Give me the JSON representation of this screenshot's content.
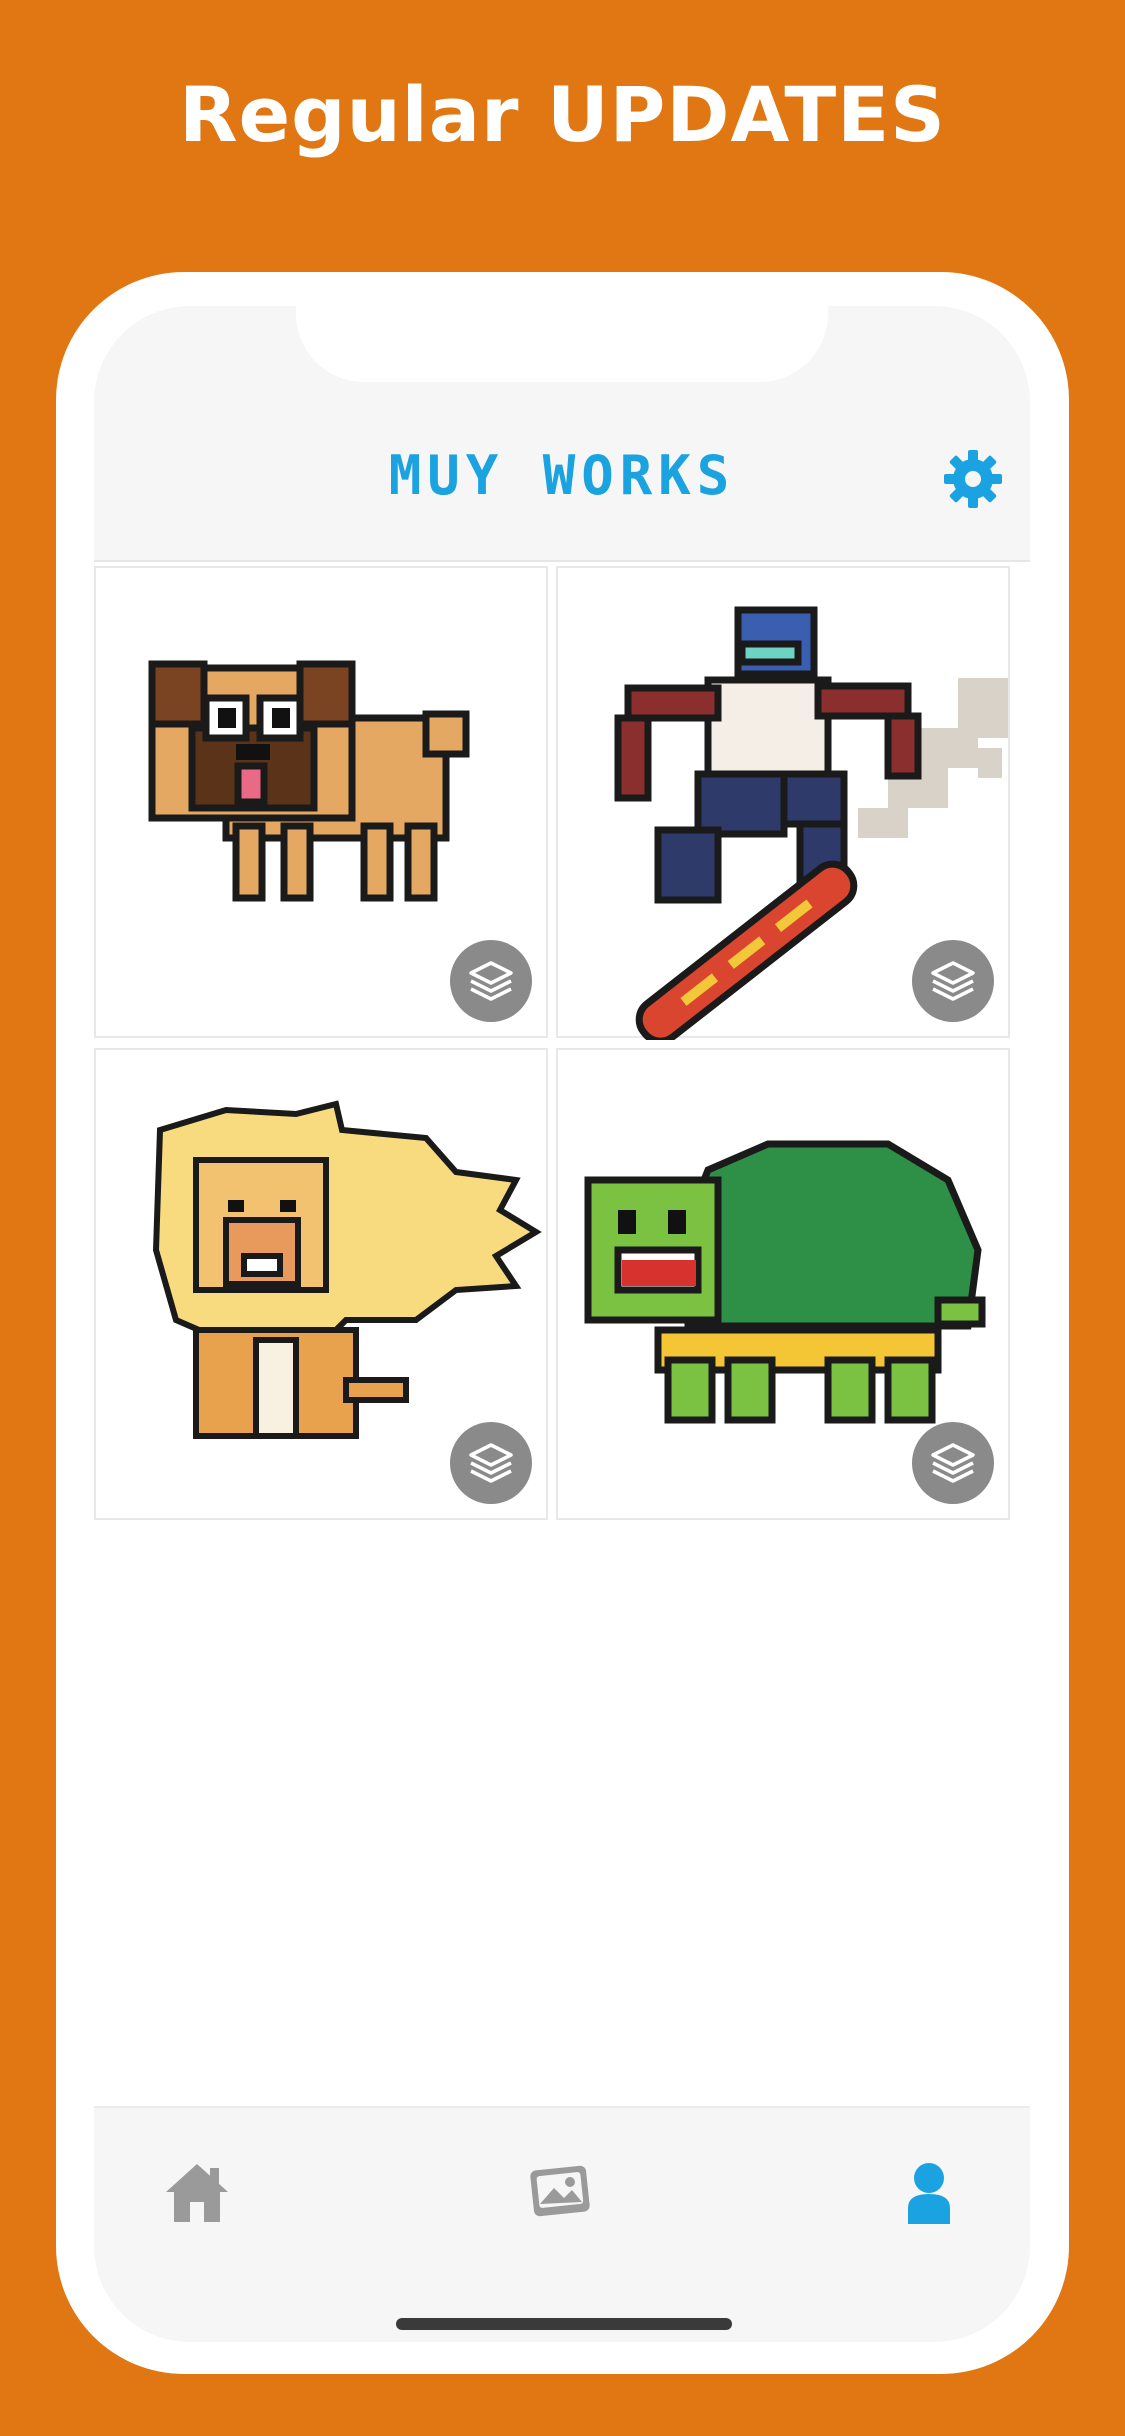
{
  "promo": {
    "headline": "Regular UPDATES"
  },
  "header": {
    "title": "MUY WORKS",
    "settings_icon": "gear-icon"
  },
  "works": [
    {
      "subject": "pug",
      "layers_icon": "layers-icon"
    },
    {
      "subject": "skateboarder",
      "layers_icon": "layers-icon"
    },
    {
      "subject": "lion",
      "layers_icon": "layers-icon"
    },
    {
      "subject": "turtle",
      "layers_icon": "layers-icon"
    }
  ],
  "tabbar": {
    "tabs": [
      {
        "icon": "home-icon",
        "active": false
      },
      {
        "icon": "gallery-icon",
        "active": false
      },
      {
        "icon": "profile-icon",
        "active": true
      }
    ]
  },
  "colors": {
    "background": "#E07712",
    "accent": "#1AA3E0",
    "inactive_tab": "#9A9A9A",
    "layers_button": "#8A8A8A"
  }
}
